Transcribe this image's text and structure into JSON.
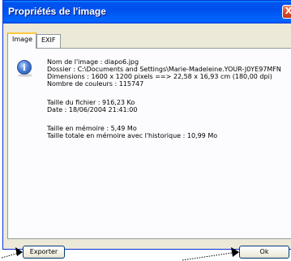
{
  "window": {
    "title": "Propriétés de l'image",
    "close_glyph": "X"
  },
  "tabs": [
    {
      "label": "Image",
      "active": true
    },
    {
      "label": "EXIF",
      "active": false
    }
  ],
  "info": {
    "icon": "info-icon",
    "lines": [
      "Nom de l'image : diapo6.jpg",
      "Dossier : C:\\Documents and Settings\\Marie-Madeleine.YOUR-J0YE97MFN",
      "Dimensions : 1600 x 1200 pixels ==> 22,58 x 16,93 cm (180,00 dpi)",
      "Nombre de couleurs : 115747",
      "Taille du fichier : 916,23 Ko",
      "Date : 18/06/2004 21:41:00",
      "Taille en mémoire : 5,49 Mo",
      "Taille totale en mémoire avec l'historique : 10,99 Mo"
    ]
  },
  "buttons": {
    "export_label": "Exporter",
    "ok_label": "Ok"
  }
}
